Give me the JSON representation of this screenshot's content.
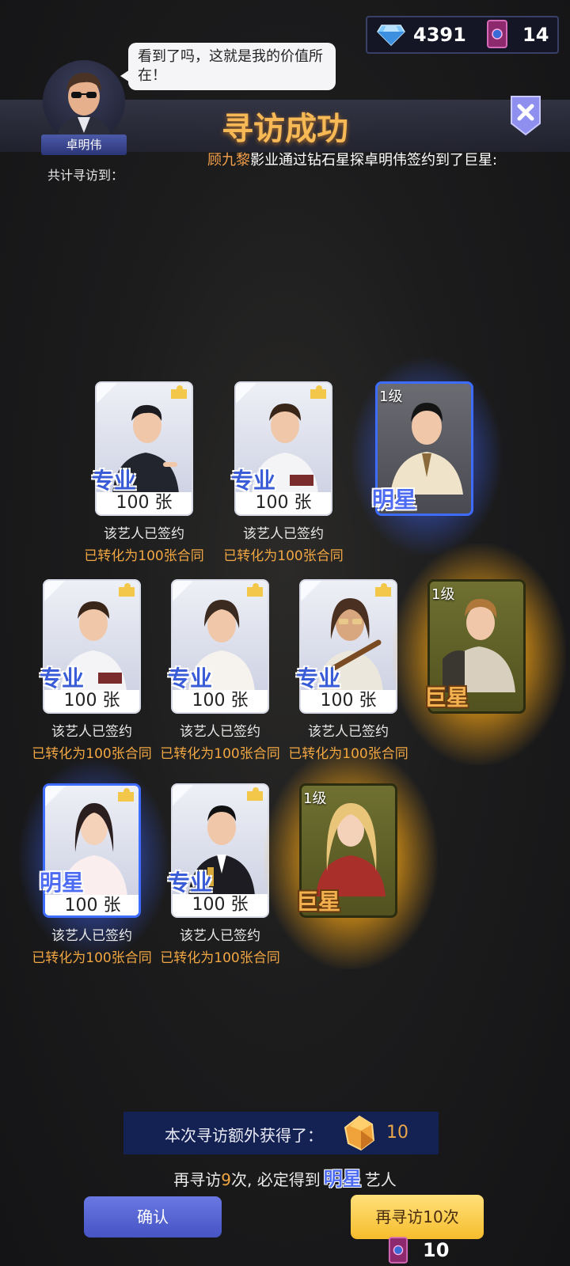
{
  "currency": {
    "diamonds": "4391",
    "tickets": "14"
  },
  "header": {
    "title": "寻访成功",
    "ticker_name": "顾九黎",
    "ticker_rest": "影业通过钻石星探卓明伟签约到了巨星:"
  },
  "scout": {
    "name": "卓明伟",
    "speech": "看到了吗，这就是我的价值所在！",
    "total_label": "共计寻访到："
  },
  "cards": [
    {
      "type": "silver",
      "rank": "专业",
      "count": "100 张",
      "signed": "该艺人已签约",
      "converted": "已转化为100张合同"
    },
    {
      "type": "silver",
      "rank": "专业",
      "count": "100 张",
      "signed": "该艺人已签约",
      "converted": "已转化为100张合同"
    },
    {
      "type": "star",
      "level": "1级",
      "rank": "明星"
    },
    {
      "type": "silver",
      "rank": "专业",
      "count": "100 张",
      "signed": "该艺人已签约",
      "converted": "已转化为100张合同"
    },
    {
      "type": "silver",
      "rank": "专业",
      "count": "100 张",
      "signed": "该艺人已签约",
      "converted": "已转化为100张合同"
    },
    {
      "type": "silver",
      "rank": "专业",
      "count": "100 张",
      "signed": "该艺人已签约",
      "converted": "已转化为100张合同"
    },
    {
      "type": "mega",
      "level": "1级",
      "rank": "巨星"
    },
    {
      "type": "silver-star",
      "rank": "明星",
      "count": "100 张",
      "signed": "该艺人已签约",
      "converted": "已转化为100张合同"
    },
    {
      "type": "silver",
      "rank": "专业",
      "count": "100 张",
      "signed": "该艺人已签约",
      "converted": "已转化为100张合同"
    },
    {
      "type": "mega",
      "level": "1级",
      "rank": "巨星"
    }
  ],
  "bonus": {
    "label": "本次寻访额外获得了：",
    "value": "10"
  },
  "pity": {
    "prefix": "再寻访",
    "count": "9",
    "middle": "次, 必定得到",
    "rank": "明星",
    "suffix": "艺人"
  },
  "buttons": {
    "confirm": "确认",
    "retry": "再寻访10次",
    "retry_cost": "10"
  },
  "colors": {
    "accent_gold": "#f6b955",
    "star_blue": "#4d6cf2",
    "mega_gold": "#ffc828"
  }
}
